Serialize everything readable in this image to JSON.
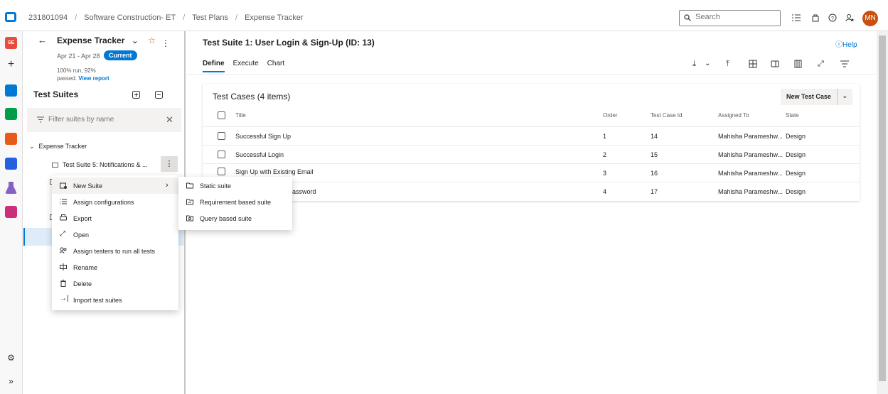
{
  "breadcrumb": [
    "231801094",
    "Software Construction- ET",
    "Test Plans",
    "Expense Tracker"
  ],
  "search": {
    "placeholder": "Search"
  },
  "user": {
    "initials": "MN"
  },
  "rail": {
    "project_initials": "SE"
  },
  "plan": {
    "name": "Expense Tracker",
    "dates": "Apr 21 - Apr 28",
    "badge": "Current",
    "stats_line1": "100% run, 92%",
    "stats_line2": "passed.",
    "view_report": "View report"
  },
  "suites": {
    "heading": "Test Suites",
    "filter_placeholder": "Filter suites by name",
    "root": "Expense Tracker",
    "first_child": "Test Suite 5: Notifications & ..."
  },
  "main": {
    "title": "Test Suite 1: User Login & Sign-Up (ID: 13)",
    "help": "Help",
    "tabs": [
      "Define",
      "Execute",
      "Chart"
    ],
    "active_tab": "Define"
  },
  "test_cases": {
    "title": "Test Cases (4 items)",
    "new_button": "New Test Case",
    "columns": [
      "Title",
      "Order",
      "Test Case Id",
      "Assigned To",
      "State"
    ],
    "rows": [
      [
        "Successful Sign Up",
        "1",
        "14",
        "Mahisha Parameshw...",
        "Design"
      ],
      [
        "Successful Login",
        "2",
        "15",
        "Mahisha Parameshw...",
        "Design"
      ],
      [
        "Sign Up with Existing Email",
        "3",
        "16",
        "Mahisha Parameshw...",
        "Design"
      ],
      [
        "Password",
        "4",
        "17",
        "Mahisha Parameshw...",
        "Design"
      ]
    ]
  },
  "context_menu": {
    "items": [
      "New Suite",
      "Assign configurations",
      "Export",
      "Open",
      "Assign testers to run all tests",
      "Rename",
      "Delete",
      "Import test suites"
    ]
  },
  "submenu": {
    "items": [
      "Static suite",
      "Requirement based suite",
      "Query based suite"
    ]
  },
  "colors": {
    "accent": "#0078d4",
    "avatar": "#ca5010"
  }
}
